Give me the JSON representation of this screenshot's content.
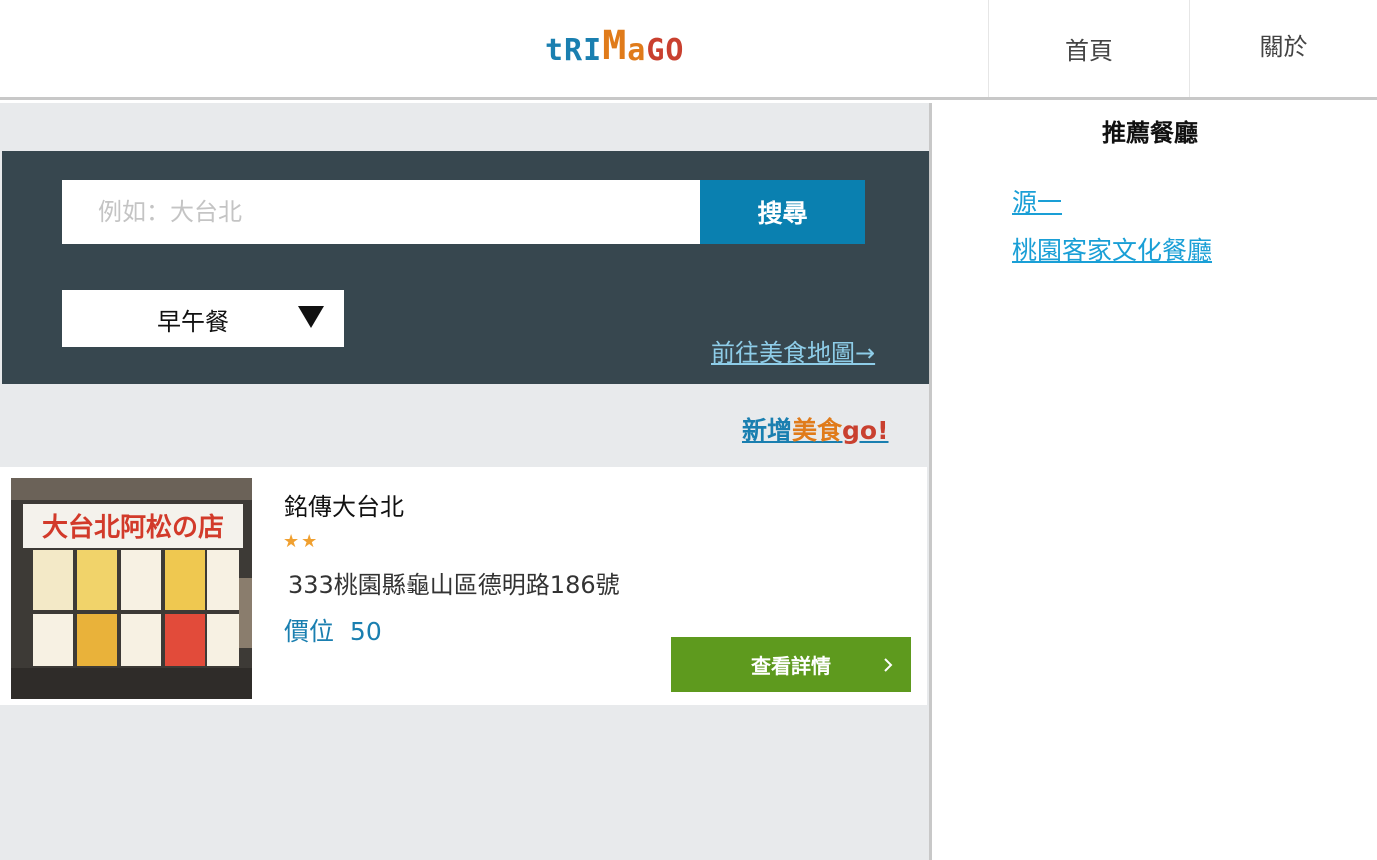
{
  "header": {
    "logo": {
      "part1": "tR",
      "part2": "I",
      "part3": "M",
      "part4": "a",
      "part5": "GO"
    },
    "nav": [
      {
        "label": "首頁"
      },
      {
        "label": "關於"
      }
    ]
  },
  "search": {
    "placeholder": "例如：大台北",
    "button_label": "搜尋",
    "category_selected": "早午餐",
    "map_link": "前往美食地圖→"
  },
  "add_link": {
    "part1": "新增",
    "part2": "美食",
    "part3": "go!"
  },
  "results": [
    {
      "name": "銘傳大台北",
      "stars": "★★",
      "address": "333桃園縣龜山區德明路186號",
      "price_label": "價位",
      "price": "50",
      "detail_button": "查看詳情",
      "image_sign": "大台北阿松の店"
    }
  ],
  "sidebar": {
    "title": "推薦餐廳",
    "items": [
      {
        "label": "源一"
      },
      {
        "label": "桃園客家文化餐廳"
      }
    ]
  },
  "colors": {
    "accent_blue": "#0a80b0",
    "search_panel": "#37474f",
    "detail_green": "#5e9a1e",
    "star_orange": "#f0a030"
  }
}
